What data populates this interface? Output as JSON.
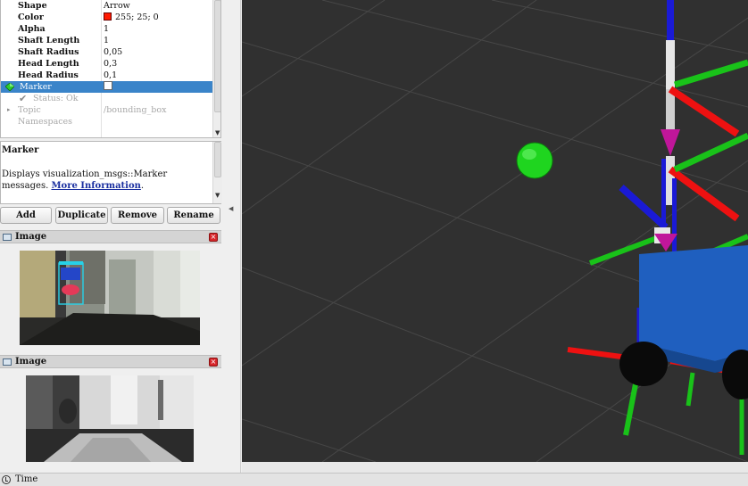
{
  "properties": {
    "rows": [
      {
        "key": "Shape",
        "value": "Arrow"
      },
      {
        "key": "Color",
        "value": "255; 25; 0"
      },
      {
        "key": "Alpha",
        "value": "1"
      },
      {
        "key": "Shaft Length",
        "value": "1"
      },
      {
        "key": "Shaft Radius",
        "value": "0,05"
      },
      {
        "key": "Head Length",
        "value": "0,3"
      },
      {
        "key": "Head Radius",
        "value": "0,1"
      }
    ],
    "marker": {
      "label": "Marker"
    },
    "status": {
      "label": "Status: Ok"
    },
    "topic": {
      "label": "Topic",
      "value": "/bounding_box"
    },
    "namespaces": {
      "label": "Namespaces"
    },
    "color_swatch": "#ff1900"
  },
  "description": {
    "title": "Marker",
    "text": "Displays visualization_msgs::Marker messages.",
    "link": "More Information",
    "after_link": "."
  },
  "buttons": {
    "add": "Add",
    "duplicate": "Duplicate",
    "remove": "Remove",
    "rename": "Rename"
  },
  "image_panels": {
    "rgb": {
      "title": "Image",
      "close": "x"
    },
    "depth": {
      "title": "Image",
      "close": "x"
    }
  },
  "statusbar": {
    "label": "Time"
  },
  "colors": {
    "selection": "#3a84c9",
    "viewport_bg": "#303030",
    "grid": "#444444",
    "axis_red": "#e11",
    "axis_green": "#19c219",
    "axis_blue": "#1a1ad6",
    "sphere": "#1fd51f",
    "robot_body": "#1f5fbf"
  },
  "icons": {
    "marker": "green-diamond-icon",
    "status": "checkmark-icon",
    "topic": "expand-arrow-icon",
    "image_panel": "image-icon",
    "close": "close-icon",
    "time": "clock-icon"
  }
}
